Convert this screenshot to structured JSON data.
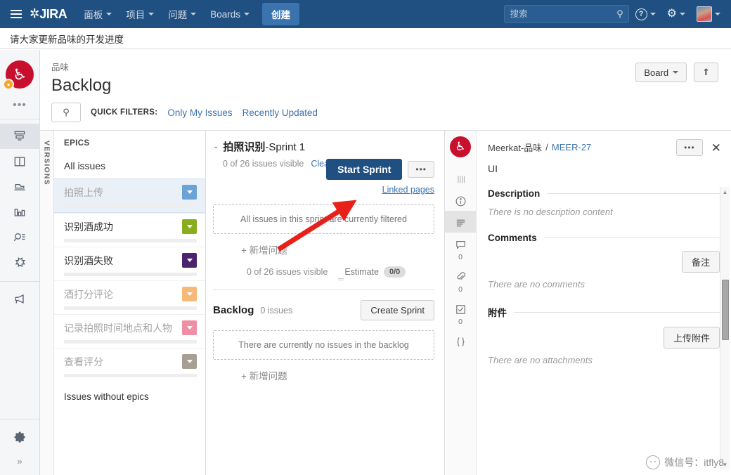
{
  "topnav": {
    "menu_icon": "hamburger-icon",
    "logo_text": "JIRA",
    "items": [
      {
        "label": "面板",
        "has_caret": true
      },
      {
        "label": "项目",
        "has_caret": true
      },
      {
        "label": "问题",
        "has_caret": true
      },
      {
        "label": "Boards",
        "has_caret": true
      }
    ],
    "create_label": "创建",
    "search_placeholder": "搜索",
    "search_value": "",
    "help_icon": "help-circle-icon",
    "settings_icon": "gear-icon",
    "avatar_icon": "user-avatar"
  },
  "banner": {
    "text": "请大家更新品味的开发进度"
  },
  "rail": {
    "project_icon": "wine-glass-icon",
    "more_label": "•••",
    "icons": [
      {
        "name": "backlog-icon",
        "active": true
      },
      {
        "name": "board-icon",
        "active": false
      },
      {
        "name": "releases-icon",
        "active": false
      },
      {
        "name": "reports-icon",
        "active": false
      },
      {
        "name": "issues-icon",
        "active": false
      },
      {
        "name": "addons-icon",
        "active": false
      }
    ],
    "announce_icon": "megaphone-icon",
    "settings_icon": "gear-icon",
    "expand_label": "»"
  },
  "page": {
    "breadcrumb": "品味",
    "title": "Backlog",
    "board_button": "Board",
    "collapse_icon": "chevron-double-up-icon"
  },
  "filters": {
    "search_icon": "search-icon",
    "label": "QUICK FILTERS:",
    "links": [
      "Only My Issues",
      "Recently Updated"
    ]
  },
  "epics": {
    "versions_tab": "VERSIONS",
    "header": "EPICS",
    "all_issues": "All issues",
    "items": [
      {
        "name": "拍照上传",
        "color": "#6ba3d6",
        "selected": true,
        "muted": true
      },
      {
        "name": "识别酒成功",
        "color": "#8aad1e",
        "selected": false,
        "muted": false
      },
      {
        "name": "识别酒失败",
        "color": "#4b236e",
        "selected": false,
        "muted": false
      },
      {
        "name": "酒打分评论",
        "color": "#f7b977",
        "selected": false,
        "muted": true
      },
      {
        "name": "记录拍照时间地点和人物",
        "color": "#ef8fa6",
        "selected": false,
        "muted": true
      },
      {
        "name": "查看评分",
        "color": "#a89e91",
        "selected": false,
        "muted": true
      }
    ],
    "without_epics": "Issues without epics"
  },
  "sprint": {
    "twisty": "⌄",
    "name_prefix": "拍照识别",
    "name_suffix": "-Sprint 1",
    "visible_count": "0 of 26 issues visible",
    "clear_filters": "Clear all filters",
    "start_button": "Start Sprint",
    "more_button": "•••",
    "linked_pages": "Linked pages",
    "empty_text": "All issues in this sprint are currently filtered",
    "add_issue": "+  新增问题",
    "footer_count": "0 of 26 issues visible",
    "estimate_label": "Estimate",
    "estimate_value": "0/0"
  },
  "backlog": {
    "title": "Backlog",
    "count": "0 issues",
    "create_sprint": "Create Sprint",
    "empty_text": "There are currently no issues in the backlog",
    "add_issue": "+  新增问题"
  },
  "detail": {
    "avatar_icon": "wine-glass-icon",
    "rail_icons": [
      {
        "name": "drag-handle-icon",
        "count": null,
        "active": false
      },
      {
        "name": "info-icon",
        "count": null,
        "active": false
      },
      {
        "name": "description-icon",
        "count": null,
        "active": true
      },
      {
        "name": "comment-icon",
        "count": "0",
        "active": false
      },
      {
        "name": "attachment-icon",
        "count": "0",
        "active": false
      },
      {
        "name": "checklist-icon",
        "count": "0",
        "active": false
      },
      {
        "name": "code-icon",
        "count": null,
        "active": false
      }
    ],
    "breadcrumb_project": "Meerkat-品味",
    "breadcrumb_sep": "/",
    "breadcrumb_key": "MEER-27",
    "more_button": "•••",
    "close_icon": "close-icon",
    "issue_title": "UI",
    "description_label": "Description",
    "description_empty": "There is no description content",
    "comments_label": "Comments",
    "comment_button": "备注",
    "comments_empty": "There are no comments",
    "attachments_label": "附件",
    "attachment_button": "上传附件",
    "attachments_empty": "There are no attachments"
  },
  "watermark": {
    "text": "微信号：itfly8"
  },
  "colors": {
    "nav_blue": "#205081",
    "primary_button": "#205081",
    "link_blue": "#3b73af",
    "annotation_red": "#e8201a",
    "project_red": "#c8102e"
  }
}
